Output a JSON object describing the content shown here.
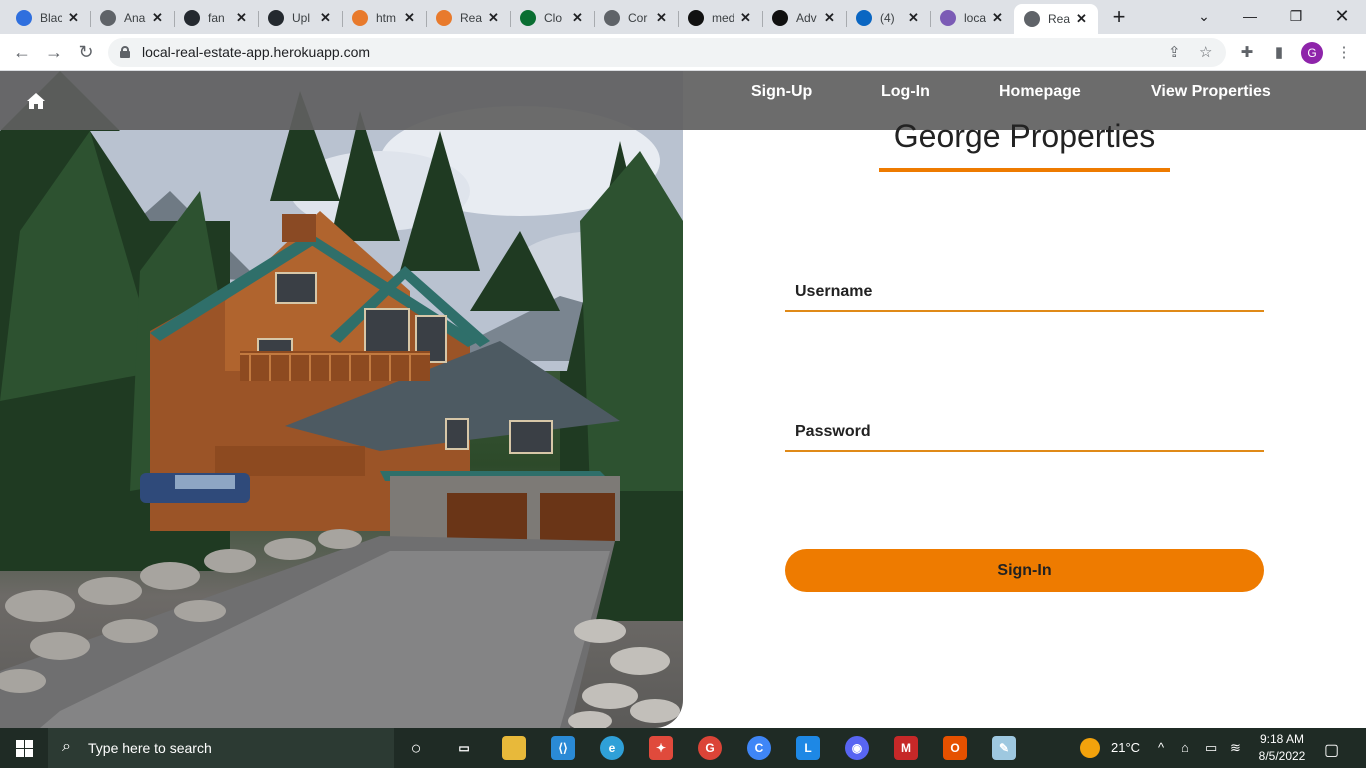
{
  "browser": {
    "tabs": [
      {
        "label": "Blac",
        "icon": "c-circle-icon",
        "color": "#2f6fde"
      },
      {
        "label": "Ana",
        "icon": "globe-icon",
        "color": "#5f6368"
      },
      {
        "label": "fan",
        "icon": "github-icon",
        "color": "#24292f"
      },
      {
        "label": "Upl",
        "icon": "github-icon",
        "color": "#24292f"
      },
      {
        "label": "htm",
        "icon": "stack-icon",
        "color": "#e87a2c"
      },
      {
        "label": "Rea",
        "icon": "stack-icon",
        "color": "#e87a2c"
      },
      {
        "label": "Clo",
        "icon": "leaf-icon",
        "color": "#0a6e32"
      },
      {
        "label": "Cor",
        "icon": "globe-icon",
        "color": "#5f6368"
      },
      {
        "label": "med",
        "icon": "medium-icon",
        "color": "#111111"
      },
      {
        "label": "Adv",
        "icon": "medium-icon",
        "color": "#111111"
      },
      {
        "label": "(4)",
        "icon": "linkedin-icon",
        "color": "#0a66c2"
      },
      {
        "label": "loca",
        "icon": "heroku-icon",
        "color": "#7b5bb5"
      },
      {
        "label": "Rea",
        "icon": "globe-icon",
        "color": "#5f6368",
        "active": true
      }
    ],
    "url": "local-real-estate-app.herokuapp.com",
    "profile_initial": "G"
  },
  "nav": {
    "links": [
      "Sign-Up",
      "Log-In",
      "Homepage",
      "View Properties"
    ]
  },
  "brand": "George Properties",
  "form": {
    "username_label": "Username",
    "password_label": "Password",
    "submit_label": "Sign-In"
  },
  "colors": {
    "accent": "#ee7b00",
    "navbar": "#5f5f5f"
  },
  "taskbar": {
    "search_placeholder": "Type here to search",
    "weather": "21°C",
    "time": "9:18 AM",
    "date": "8/5/2022"
  }
}
